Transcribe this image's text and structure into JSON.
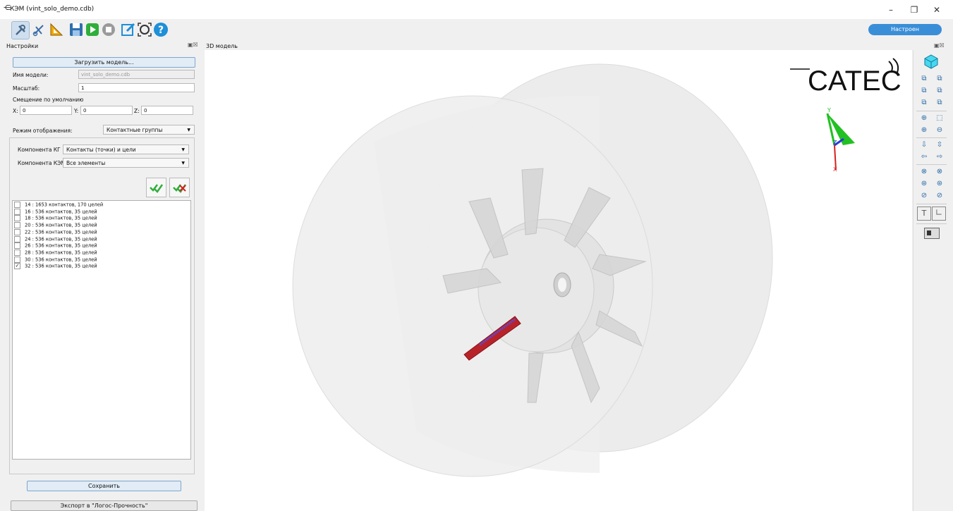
{
  "window": {
    "title": "КЭМ (vint_solo_demo.cdb)",
    "minimize": "–",
    "restore": "❐",
    "close": "✕"
  },
  "toolbar": {
    "status_label": "Настроен",
    "icons": [
      "settings-icon",
      "cut-icon",
      "measure-icon",
      "save-icon",
      "run-icon",
      "stop-icon",
      "edit-icon",
      "fit-icon",
      "help-icon"
    ]
  },
  "settings_panel": {
    "title": "Настройки",
    "load_button": "Загрузить модель...",
    "model_name_label": "Имя модели:",
    "model_name_value": "vint_solo_demo.cdb",
    "scale_label": "Масштаб:",
    "scale_value": "1",
    "offset_label": "Смещение по умолчанию",
    "x_label": "X:",
    "x_value": "0",
    "y_label": "Y:",
    "y_value": "0",
    "z_label": "Z:",
    "z_value": "0",
    "display_mode_label": "Режим отображения:",
    "display_mode_value": "Контактные группы",
    "kg_component_label": "Компонента КГ",
    "kg_component_value": "Контакты (точки) и цели",
    "kem_component_label": "Компонента КЭМ",
    "kem_component_value": "Все элементы",
    "contact_groups": [
      {
        "label": "14 : 1653 контактов, 170 целей",
        "checked": false
      },
      {
        "label": "16 : 536 контактов, 35 целей",
        "checked": false
      },
      {
        "label": "18 : 536 контактов, 35 целей",
        "checked": false
      },
      {
        "label": "20 : 536 контактов, 35 целей",
        "checked": false
      },
      {
        "label": "22 : 536 контактов, 35 целей",
        "checked": false
      },
      {
        "label": "24 : 536 контактов, 35 целей",
        "checked": false
      },
      {
        "label": "26 : 536 контактов, 35 целей",
        "checked": false
      },
      {
        "label": "28 : 536 контактов, 35 целей",
        "checked": false
      },
      {
        "label": "30 : 536 контактов, 35 целей",
        "checked": false
      },
      {
        "label": "32 : 536 контактов, 35 целей",
        "checked": true
      }
    ],
    "check_marks": [
      "",
      "",
      "",
      "",
      "",
      "",
      "",
      "",
      "",
      "✓"
    ],
    "save_button": "Сохранить",
    "export_button": "Экспорт в \"Логос-Прочность\""
  },
  "viewport": {
    "title": "3D модель",
    "logo_text": "CATEC",
    "axis_y": "Y",
    "axis_z": "Z",
    "axis_x": "X"
  },
  "colors": {
    "accent": "#3a8ed8",
    "highlight_part": "#b8232a",
    "axis_x": "#d42020",
    "axis_y": "#22c022",
    "axis_z": "#2a3ad8"
  }
}
